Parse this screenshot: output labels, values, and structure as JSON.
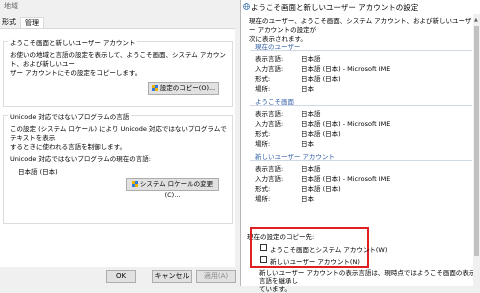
{
  "bg": {
    "title": "地域",
    "tabs": [
      "形式",
      "管理"
    ],
    "welcome_group": {
      "legend": "ようこそ画面と新しいユーザー アカウント",
      "desc_lines": [
        "お使いの地域と言語の設定を表示して、ようこそ画面、システム アカウント、および新しいユー",
        "ザー アカウントにその設定をコピーします。"
      ],
      "button": "設定のコピー(O)..."
    },
    "unicode_group": {
      "legend": "Unicode 対応ではないプログラムの言語",
      "desc_lines": [
        "この設定 (システム ロケール) により Unicode 対応ではないプログラムでテキストを表示",
        "するときに使われる言語を制御します。"
      ],
      "current_label": "Unicode 対応ではないプログラムの現在の言語:",
      "current_value": "日本語 (日本)",
      "button": "システム ロケールの変更(C)..."
    },
    "buttons": {
      "ok": "OK",
      "cancel": "キャンセル",
      "apply": "適用(A)"
    }
  },
  "fg": {
    "title": "ようこそ画面と新しいユーザー アカウントの設定",
    "intro_lines": [
      "現在のユーザー、ようこそ画面、システム アカウント、および新しいユーザー アカウントの設定が",
      "次に表示されます。"
    ],
    "sections": [
      {
        "header": "現在のユーザー",
        "rows": [
          {
            "label": "表示言語:",
            "value": "日本語"
          },
          {
            "label": "入力言語:",
            "value": "日本語 (日本) - Microsoft IME"
          },
          {
            "label": "形式:",
            "value": "日本語 (日本)"
          },
          {
            "label": "場所:",
            "value": "日本"
          }
        ]
      },
      {
        "header": "ようこそ画面",
        "rows": [
          {
            "label": "表示言語:",
            "value": "日本語"
          },
          {
            "label": "入力言語:",
            "value": "日本語 (日本) - Microsoft IME"
          },
          {
            "label": "形式:",
            "value": "日本語 (日本)"
          },
          {
            "label": "場所:",
            "value": "日本"
          }
        ]
      },
      {
        "header": "新しいユーザー アカウント",
        "rows": [
          {
            "label": "表示言語:",
            "value": "日本語"
          },
          {
            "label": "入力言語:",
            "value": "日本語 (日本) - Microsoft IME"
          },
          {
            "label": "形式:",
            "value": "日本語 (日本)"
          },
          {
            "label": "場所:",
            "value": "日本"
          }
        ]
      }
    ],
    "copy_label": "現在の設定のコピー先:",
    "checkbox1": "ようこそ画面とシステム アカウント(W)",
    "checkbox2": "新しいユーザー アカウント(N)",
    "footer_lines": [
      "新しいユーザー アカウントの表示言語は、現時点ではようこそ画面の表示言語を継承し",
      "ています。"
    ]
  },
  "colors": {
    "accent": "#2f5ea8",
    "highlight": "#e02020"
  }
}
